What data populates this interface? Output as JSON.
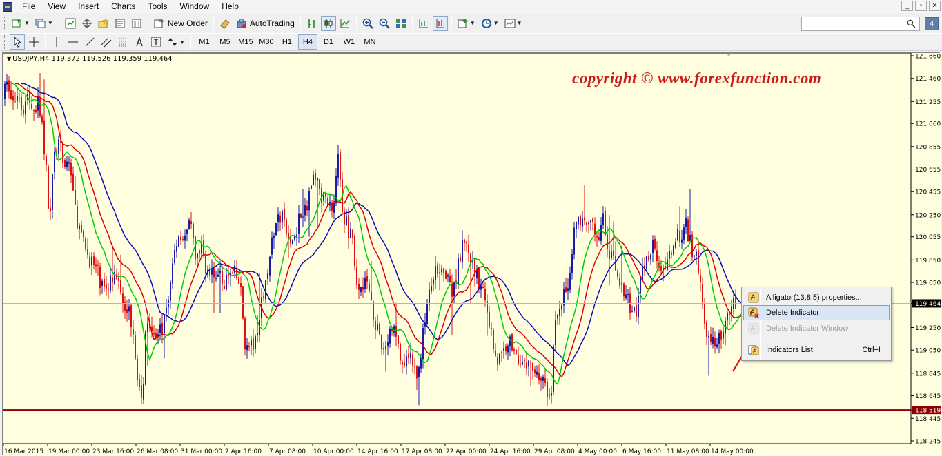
{
  "menubar": {
    "items": [
      "File",
      "View",
      "Insert",
      "Charts",
      "Tools",
      "Window",
      "Help"
    ],
    "window_controls": [
      "_",
      "▫",
      "✕"
    ]
  },
  "toolbar": {
    "new_order_label": "New Order",
    "autotrading_label": "AutoTrading",
    "help_label": "4",
    "search_placeholder": ""
  },
  "timeframes": [
    "M1",
    "M5",
    "M15",
    "M30",
    "H1",
    "H4",
    "D1",
    "W1",
    "MN"
  ],
  "active_timeframe": "H4",
  "chart_header": {
    "symbol": "USDJPY,H4",
    "ohlc": "119.372 119.526 119.359 119.464"
  },
  "watermark": "copyright ©  www.forexfunction.com",
  "context_menu": {
    "items": [
      {
        "label": "Alligator(13,8,5) properties...",
        "shortcut": "",
        "state": "normal"
      },
      {
        "label": "Delete Indicator",
        "shortcut": "",
        "state": "hover"
      },
      {
        "label": "Delete Indicator Window",
        "shortcut": "",
        "state": "disabled"
      },
      {
        "label": "Indicators List",
        "shortcut": "Ctrl+I",
        "state": "normal"
      }
    ]
  },
  "colors": {
    "chart_bg": "#ffffe0",
    "bull_candle": "#1a1aa8",
    "bear_candle": "#e01010",
    "jaw": "#0a0ab4",
    "teeth": "#dd0000",
    "lips": "#00cc00",
    "hline": "#8b0000",
    "watermark": "#cc1a1a",
    "arrow": "#dd1111"
  },
  "chart_data": {
    "type": "candlestick",
    "symbol": "USDJPY",
    "timeframe": "H4",
    "ylim": [
      118.245,
      121.66
    ],
    "y_ticks": [
      "121.660",
      "121.460",
      "121.255",
      "121.060",
      "120.855",
      "120.655",
      "120.455",
      "120.250",
      "120.055",
      "119.850",
      "119.650",
      "119.464",
      "119.250",
      "119.050",
      "118.845",
      "118.645",
      "118.519",
      "118.445",
      "118.245"
    ],
    "x_labels": [
      "16 Mar 2015",
      "19 Mar 00:00",
      "23 Mar 16:00",
      "26 Mar 08:00",
      "31 Mar 00:00",
      "2 Apr 16:00",
      "7 Apr 08:00",
      "10 Apr 00:00",
      "14 Apr 16:00",
      "17 Apr 08:00",
      "22 Apr 00:00",
      "24 Apr 16:00",
      "29 Apr 08:00",
      "4 May 00:00",
      "6 May 16:00",
      "11 May 08:00",
      "14 May 00:00"
    ],
    "current_price": 119.464,
    "horizontal_line": 118.519,
    "price_path": [
      [
        0,
        121.3
      ],
      [
        8,
        121.42
      ],
      [
        14,
        121.22
      ],
      [
        22,
        121.35
      ],
      [
        30,
        121.2
      ],
      [
        36,
        121.3
      ],
      [
        44,
        121.18
      ],
      [
        52,
        121.25
      ],
      [
        58,
        121.0
      ],
      [
        64,
        120.55
      ],
      [
        68,
        120.15
      ],
      [
        74,
        120.75
      ],
      [
        82,
        120.9
      ],
      [
        88,
        120.65
      ],
      [
        96,
        120.75
      ],
      [
        102,
        120.4
      ],
      [
        110,
        120.15
      ],
      [
        118,
        119.95
      ],
      [
        128,
        119.85
      ],
      [
        138,
        119.72
      ],
      [
        148,
        119.55
      ],
      [
        158,
        119.72
      ],
      [
        166,
        119.62
      ],
      [
        174,
        119.5
      ],
      [
        182,
        119.42
      ],
      [
        190,
        119.2
      ],
      [
        196,
        118.75
      ],
      [
        202,
        118.55
      ],
      [
        208,
        119.35
      ],
      [
        216,
        119.3
      ],
      [
        224,
        119.15
      ],
      [
        232,
        119.25
      ],
      [
        240,
        119.5
      ],
      [
        248,
        119.9
      ],
      [
        256,
        120.1
      ],
      [
        264,
        120.05
      ],
      [
        272,
        120.15
      ],
      [
        280,
        119.85
      ],
      [
        288,
        119.95
      ],
      [
        296,
        119.75
      ],
      [
        304,
        119.7
      ],
      [
        312,
        119.75
      ],
      [
        320,
        119.65
      ],
      [
        328,
        119.7
      ],
      [
        336,
        119.72
      ],
      [
        344,
        119.62
      ],
      [
        352,
        119.05
      ],
      [
        360,
        119.08
      ],
      [
        368,
        119.12
      ],
      [
        376,
        119.5
      ],
      [
        384,
        119.8
      ],
      [
        392,
        120.05
      ],
      [
        400,
        120.25
      ],
      [
        408,
        120.18
      ],
      [
        416,
        119.95
      ],
      [
        424,
        120.1
      ],
      [
        432,
        120.3
      ],
      [
        440,
        120.25
      ],
      [
        448,
        120.6
      ],
      [
        456,
        120.55
      ],
      [
        462,
        120.38
      ],
      [
        470,
        120.4
      ],
      [
        478,
        120.28
      ],
      [
        486,
        120.8
      ],
      [
        492,
        120.25
      ],
      [
        500,
        120.15
      ],
      [
        508,
        119.95
      ],
      [
        516,
        119.55
      ],
      [
        524,
        119.7
      ],
      [
        532,
        119.55
      ],
      [
        540,
        119.3
      ],
      [
        548,
        119.05
      ],
      [
        556,
        119.1
      ],
      [
        564,
        119.25
      ],
      [
        572,
        119.15
      ],
      [
        580,
        118.8
      ],
      [
        588,
        119.05
      ],
      [
        596,
        118.85
      ],
      [
        604,
        118.9
      ],
      [
        612,
        119.35
      ],
      [
        620,
        119.6
      ],
      [
        628,
        119.75
      ],
      [
        636,
        119.85
      ],
      [
        644,
        119.65
      ],
      [
        652,
        119.55
      ],
      [
        660,
        119.8
      ],
      [
        668,
        120.0
      ],
      [
        676,
        119.85
      ],
      [
        684,
        119.75
      ],
      [
        692,
        119.6
      ],
      [
        700,
        119.5
      ],
      [
        708,
        119.2
      ],
      [
        716,
        118.95
      ],
      [
        724,
        119.0
      ],
      [
        732,
        119.15
      ],
      [
        740,
        119.05
      ],
      [
        748,
        119.0
      ],
      [
        756,
        118.9
      ],
      [
        764,
        118.95
      ],
      [
        772,
        118.85
      ],
      [
        780,
        118.8
      ],
      [
        788,
        118.7
      ],
      [
        794,
        118.6
      ],
      [
        800,
        119.25
      ],
      [
        808,
        119.5
      ],
      [
        816,
        119.55
      ],
      [
        824,
        119.8
      ],
      [
        830,
        120.2
      ],
      [
        838,
        120.15
      ],
      [
        846,
        120.1
      ],
      [
        854,
        120.15
      ],
      [
        862,
        120.05
      ],
      [
        870,
        120.2
      ],
      [
        878,
        119.9
      ],
      [
        886,
        119.8
      ],
      [
        894,
        119.65
      ],
      [
        902,
        119.5
      ],
      [
        910,
        119.45
      ],
      [
        918,
        119.35
      ],
      [
        926,
        119.75
      ],
      [
        934,
        119.85
      ],
      [
        942,
        120.05
      ],
      [
        950,
        119.85
      ],
      [
        958,
        119.7
      ],
      [
        966,
        119.85
      ],
      [
        974,
        120.1
      ],
      [
        982,
        120.0
      ],
      [
        990,
        120.15
      ],
      [
        998,
        119.95
      ],
      [
        1006,
        119.85
      ],
      [
        1012,
        119.65
      ],
      [
        1018,
        119.15
      ],
      [
        1026,
        119.1
      ],
      [
        1034,
        119.15
      ],
      [
        1042,
        119.1
      ],
      [
        1050,
        119.35
      ],
      [
        1058,
        119.5
      ],
      [
        1064,
        119.46
      ]
    ],
    "indicators": [
      {
        "name": "Alligator(13,8,5)",
        "lines": [
          "jaw",
          "teeth",
          "lips"
        ]
      }
    ]
  }
}
